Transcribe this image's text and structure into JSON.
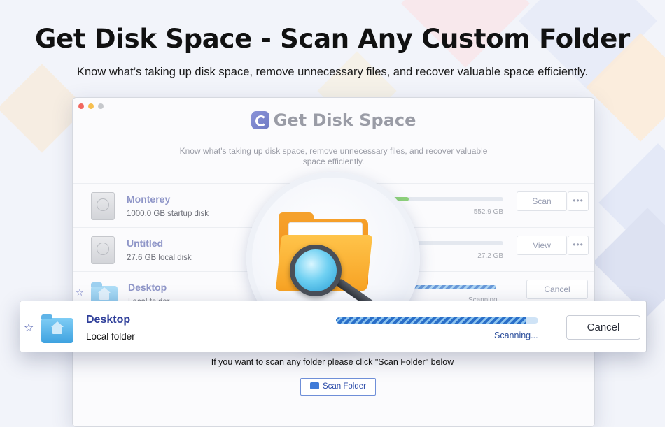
{
  "headline": "Get Disk Space - Scan Any Custom Folder",
  "subline": "Know what’s taking up disk space, remove unnecessary files, and recover valuable space efficiently.",
  "window": {
    "title": "Get Disk Space",
    "subtitle": "Know what's taking up disk space, remove unnecessary files, and recover valuable space efficiently.",
    "more_label": "•••",
    "rows": [
      {
        "name": "Monterey",
        "desc": "1000.0 GB startup disk",
        "size": "552.9 GB",
        "button": "Scan",
        "usage": 0.18
      },
      {
        "name": "Untitled",
        "desc": "27.6 GB local disk",
        "size": "27.2 GB",
        "button": "View",
        "usage": 0.0
      },
      {
        "name": "Desktop",
        "desc": "Local folder",
        "status": "Scanning...",
        "button": "Cancel"
      }
    ]
  },
  "overlay": {
    "name": "Desktop",
    "desc": "Local folder",
    "status": "Scanning...",
    "cancel_label": "Cancel",
    "progress": 0.94
  },
  "hint": "If you want to scan any folder please click \"Scan Folder\" below",
  "scan_folder_label": "Scan Folder",
  "colors": {
    "accent": "#2f3f9a",
    "progress": "#2a6fc9",
    "usage": "#8ed27a",
    "folder": "#3ea2e0"
  }
}
